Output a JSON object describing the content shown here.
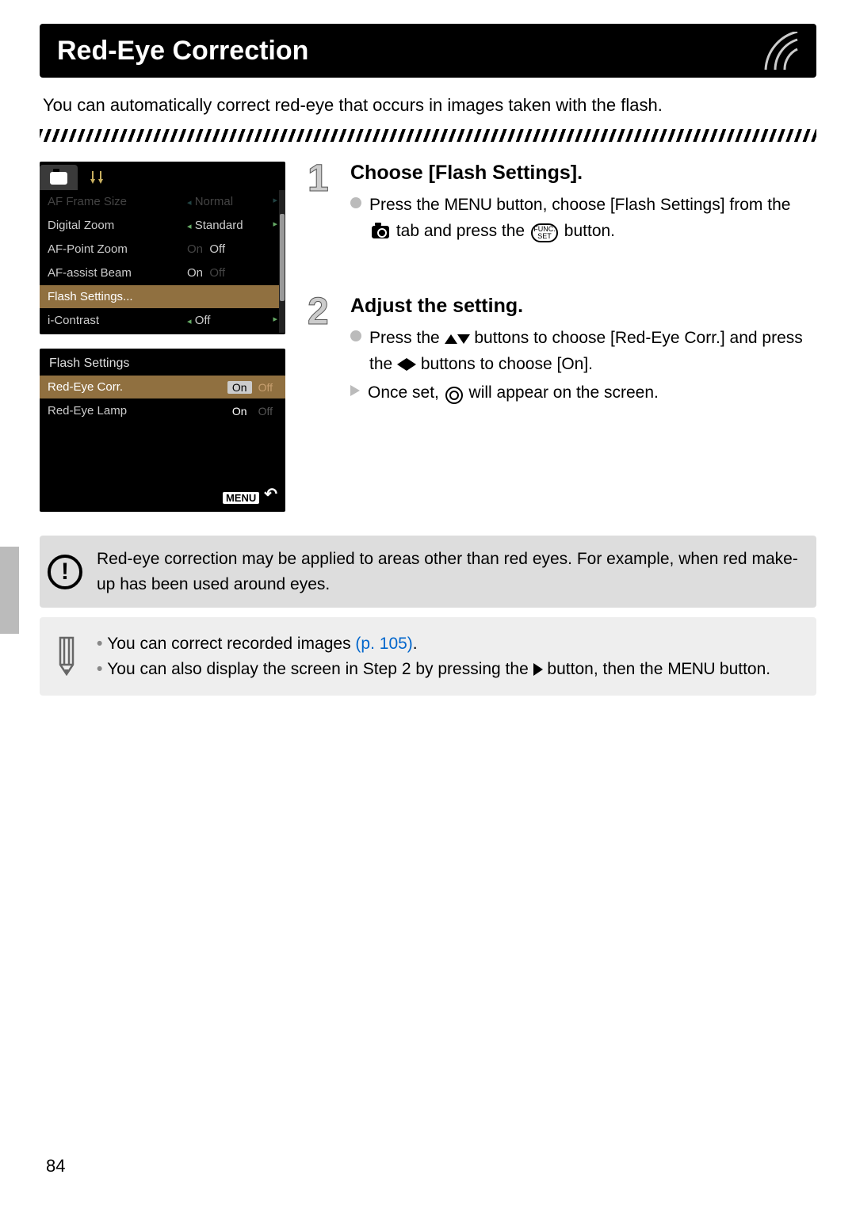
{
  "page_number": "84",
  "header": {
    "title": "Red-Eye Correction"
  },
  "intro": "You can automatically correct red-eye that occurs in images taken with the flash.",
  "lcd_menu": {
    "rows": [
      {
        "label": "AF Frame Size",
        "value": "Normal",
        "dim": true,
        "arrows": true
      },
      {
        "label": "Digital Zoom",
        "value": "Standard",
        "dim": false,
        "arrows": true
      },
      {
        "label": "AF-Point Zoom",
        "value": "Off",
        "prefix": "On",
        "dim": false,
        "toggle_dim_prefix": true
      },
      {
        "label": "AF-assist Beam",
        "value": "On",
        "suffix": "Off",
        "dim": false,
        "toggle_dim_suffix": true
      },
      {
        "label": "Flash Settings...",
        "value": "",
        "selected": true
      },
      {
        "label": "i-Contrast",
        "value": "Off",
        "arrows": true
      }
    ]
  },
  "lcd_flash": {
    "title": "Flash Settings",
    "rows": [
      {
        "label": "Red-Eye Corr.",
        "on": "On",
        "off": "Off",
        "active": "on",
        "highlight": true
      },
      {
        "label": "Red-Eye Lamp",
        "on": "On",
        "off": "Off",
        "active": "on",
        "highlight": false
      }
    ],
    "footer": "MENU"
  },
  "steps": [
    {
      "num": "1",
      "title": "Choose [Flash Settings].",
      "lines": [
        {
          "type": "dot",
          "text_before": "Press the ",
          "menu_word": "MENU",
          "text_mid1": " button, choose [Flash Settings] from the ",
          "camera_icon": true,
          "text_mid2": " tab and press the ",
          "func_set": true,
          "text_after": " button."
        }
      ]
    },
    {
      "num": "2",
      "title": "Adjust the setting.",
      "lines": [
        {
          "type": "dot",
          "text_before": "Press the ",
          "updown": true,
          "text_mid1": " buttons to choose [Red-Eye Corr.] and press the ",
          "leftright": true,
          "text_after": " buttons to choose [On]."
        },
        {
          "type": "arrow",
          "text_before": "Once set, ",
          "eye_icon": true,
          "text_after": " will appear on the screen."
        }
      ]
    }
  ],
  "note": "Red-eye correction may be applied to areas other than red eyes. For example, when red make-up has been used around eyes.",
  "tips": {
    "item1_before": "You can correct recorded images ",
    "item1_link": "(p. 105)",
    "item1_after": ".",
    "item2_before": "You can also display the screen in Step 2 by pressing the ",
    "item2_mid": " button, then the ",
    "item2_menu": "MENU",
    "item2_after": " button."
  }
}
